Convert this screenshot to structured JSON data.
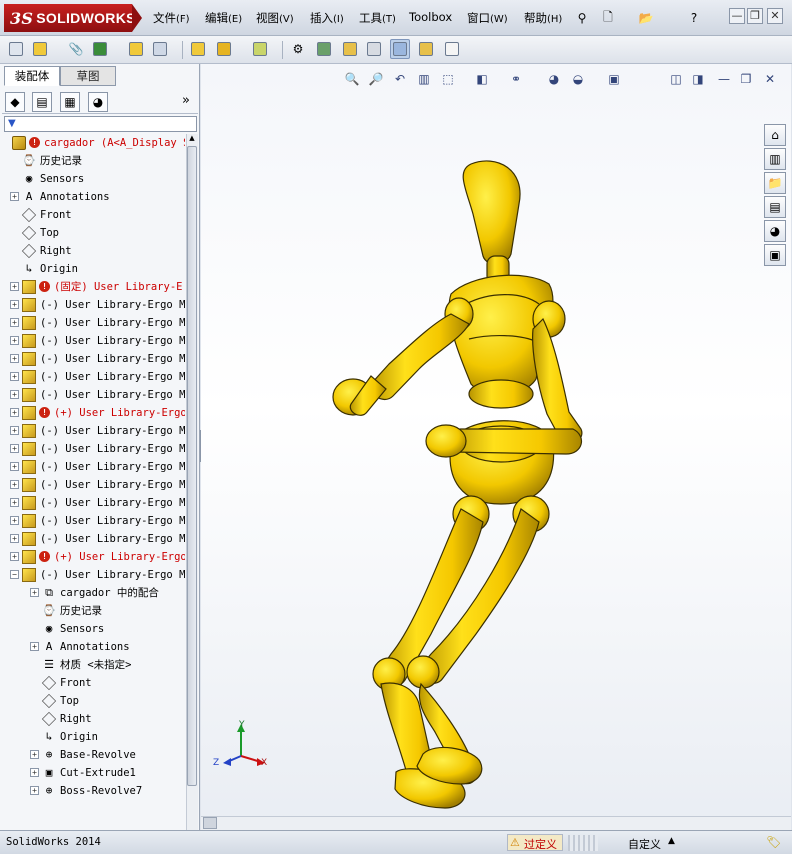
{
  "app": {
    "logo_text": "SOLIDWORKS",
    "logo_prefix": "3S"
  },
  "menu": [
    {
      "label": "文件",
      "key": "(F)"
    },
    {
      "label": "编辑",
      "key": "(E)"
    },
    {
      "label": "视图",
      "key": "(V)"
    },
    {
      "label": "插入",
      "key": "(I)"
    },
    {
      "label": "工具",
      "key": "(T)"
    },
    {
      "label": "Toolbox",
      "key": ""
    },
    {
      "label": "窗口",
      "key": "(W)"
    },
    {
      "label": "帮助",
      "key": "(H)"
    }
  ],
  "window_buttons": {
    "minimize": "—",
    "restore": "❐",
    "close": "✕"
  },
  "tabs": {
    "assembly": "装配体",
    "sketch": "草图"
  },
  "tree": [
    {
      "label": "cargador  (A<A_Display S",
      "icon": "assembly-icon",
      "depth": 0,
      "red": true,
      "warn": true,
      "expand": ""
    },
    {
      "label": "历史记录",
      "icon": "history-icon",
      "depth": 1,
      "expand": ""
    },
    {
      "label": "Sensors",
      "icon": "sensors-icon",
      "depth": 1,
      "expand": ""
    },
    {
      "label": "Annotations",
      "icon": "annotations-icon",
      "depth": 1,
      "expand": "+"
    },
    {
      "label": "Front",
      "icon": "plane-icon",
      "depth": 1,
      "expand": ""
    },
    {
      "label": "Top",
      "icon": "plane-icon",
      "depth": 1,
      "expand": ""
    },
    {
      "label": "Right",
      "icon": "plane-icon",
      "depth": 1,
      "expand": ""
    },
    {
      "label": "Origin",
      "icon": "origin-icon",
      "depth": 1,
      "expand": ""
    },
    {
      "label": "(固定) User Library-E",
      "icon": "part-icon",
      "depth": 1,
      "red": true,
      "warn": true,
      "expand": "+"
    },
    {
      "label": "(-) User Library-Ergo Ma",
      "icon": "part-icon",
      "depth": 1,
      "expand": "+"
    },
    {
      "label": "(-) User Library-Ergo Ma",
      "icon": "part-icon",
      "depth": 1,
      "expand": "+"
    },
    {
      "label": "(-) User Library-Ergo Ma",
      "icon": "part-icon",
      "depth": 1,
      "expand": "+"
    },
    {
      "label": "(-) User Library-Ergo Ma",
      "icon": "part-icon",
      "depth": 1,
      "expand": "+"
    },
    {
      "label": "(-) User Library-Ergo Ma",
      "icon": "part-icon",
      "depth": 1,
      "expand": "+"
    },
    {
      "label": "(-) User Library-Ergo Ma",
      "icon": "part-icon",
      "depth": 1,
      "expand": "+"
    },
    {
      "label": "(+) User Library-Ergo",
      "icon": "part-icon",
      "depth": 1,
      "red": true,
      "warn": true,
      "expand": "+"
    },
    {
      "label": "(-) User Library-Ergo Ma",
      "icon": "part-icon",
      "depth": 1,
      "expand": "+"
    },
    {
      "label": "(-) User Library-Ergo Ma",
      "icon": "part-icon",
      "depth": 1,
      "expand": "+"
    },
    {
      "label": "(-) User Library-Ergo Ma",
      "icon": "part-icon",
      "depth": 1,
      "expand": "+"
    },
    {
      "label": "(-) User Library-Ergo Ma",
      "icon": "part-icon",
      "depth": 1,
      "expand": "+"
    },
    {
      "label": "(-) User Library-Ergo Ma",
      "icon": "part-icon",
      "depth": 1,
      "expand": "+"
    },
    {
      "label": "(-) User Library-Ergo Ma",
      "icon": "part-icon",
      "depth": 1,
      "expand": "+"
    },
    {
      "label": "(-) User Library-Ergo Ma",
      "icon": "part-icon",
      "depth": 1,
      "expand": "+"
    },
    {
      "label": "(+) User Library-Ergo",
      "icon": "part-icon",
      "depth": 1,
      "red": true,
      "warn": true,
      "expand": "+"
    },
    {
      "label": "(-) User Library-Ergo Ma",
      "icon": "part-icon",
      "depth": 1,
      "expand": "−"
    },
    {
      "label": "cargador 中的配合",
      "icon": "mates-icon",
      "depth": 2,
      "expand": "+"
    },
    {
      "label": "历史记录",
      "icon": "history-icon",
      "depth": 2,
      "expand": ""
    },
    {
      "label": "Sensors",
      "icon": "sensors-icon",
      "depth": 2,
      "expand": ""
    },
    {
      "label": "Annotations",
      "icon": "annotations-icon",
      "depth": 2,
      "expand": "+"
    },
    {
      "label": "材质 <未指定>",
      "icon": "material-icon",
      "depth": 2,
      "expand": ""
    },
    {
      "label": "Front",
      "icon": "plane-icon",
      "depth": 2,
      "expand": ""
    },
    {
      "label": "Top",
      "icon": "plane-icon",
      "depth": 2,
      "expand": ""
    },
    {
      "label": "Right",
      "icon": "plane-icon",
      "depth": 2,
      "expand": ""
    },
    {
      "label": "Origin",
      "icon": "origin-icon",
      "depth": 2,
      "expand": ""
    },
    {
      "label": "Base-Revolve",
      "icon": "revolve-icon",
      "depth": 2,
      "expand": "+"
    },
    {
      "label": "Cut-Extrude1",
      "icon": "extrude-icon",
      "depth": 2,
      "expand": "+"
    },
    {
      "label": "Boss-Revolve7",
      "icon": "revolve-icon",
      "depth": 2,
      "expand": "+"
    }
  ],
  "triad": {
    "x": "X",
    "y": "Y",
    "z": "Z"
  },
  "status": {
    "app_version": "SolidWorks 2014",
    "overdefined": "过定义",
    "custom": "自定义"
  },
  "colors": {
    "model_yellow": "#f5d000",
    "overdefined_red": "#c00000"
  }
}
